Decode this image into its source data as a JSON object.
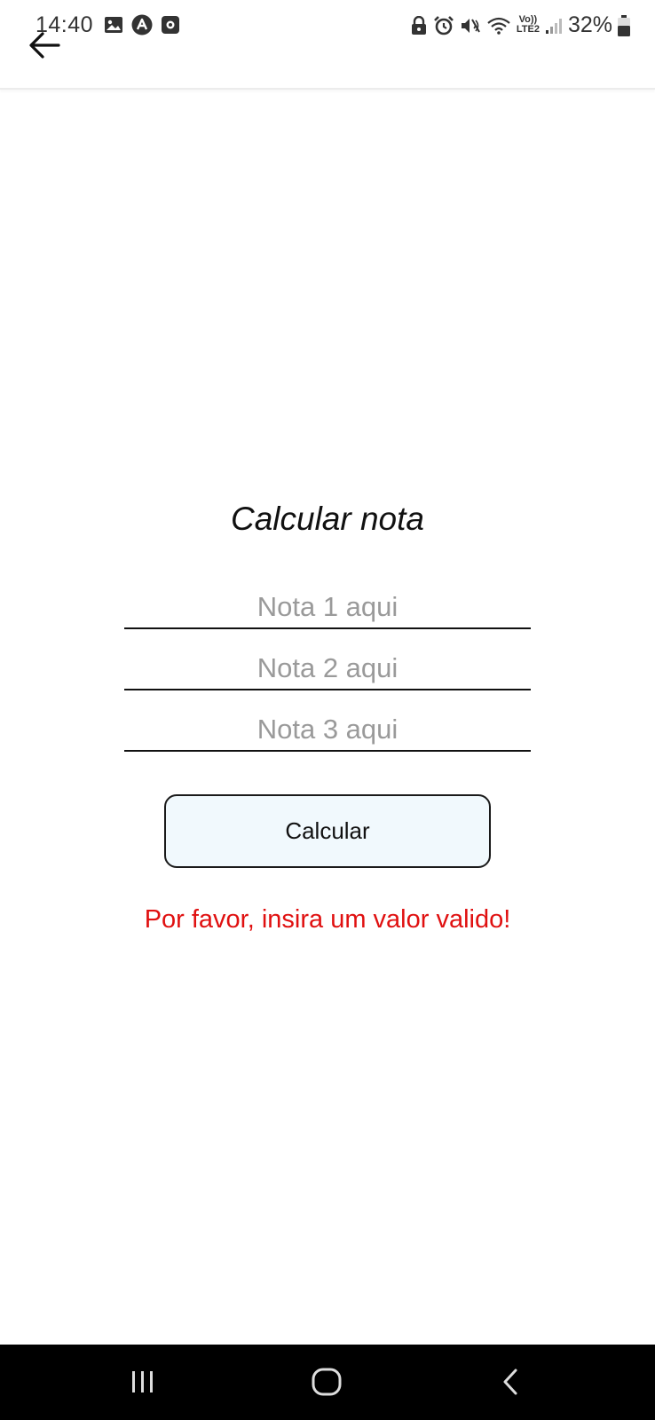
{
  "status_bar": {
    "time": "14:40",
    "left_icons": [
      "gallery-icon",
      "app-notification-icon",
      "record-icon"
    ],
    "right_icons": [
      "lock-icon",
      "alarm-icon",
      "mute-icon",
      "wifi-icon",
      "volte-lte2-icon",
      "signal-icon",
      "battery-icon"
    ],
    "volte_text": "Vo))",
    "lte_text": "LTE2",
    "battery_percent": "32%"
  },
  "app_bar": {
    "back_icon": "arrow-left-icon"
  },
  "form": {
    "title": "Calcular nota",
    "fields": [
      {
        "placeholder": "Nota 1 aqui",
        "value": ""
      },
      {
        "placeholder": "Nota 2 aqui",
        "value": ""
      },
      {
        "placeholder": "Nota 3 aqui",
        "value": ""
      }
    ],
    "submit_label": "Calcular",
    "error_message": "Por favor, insira um valor valido!"
  },
  "nav_bar": {
    "icons": [
      "recents-icon",
      "home-icon",
      "back-icon"
    ]
  },
  "colors": {
    "error": "#e01010",
    "button_bg": "#f1f9fd",
    "placeholder": "#9a9a9a"
  }
}
